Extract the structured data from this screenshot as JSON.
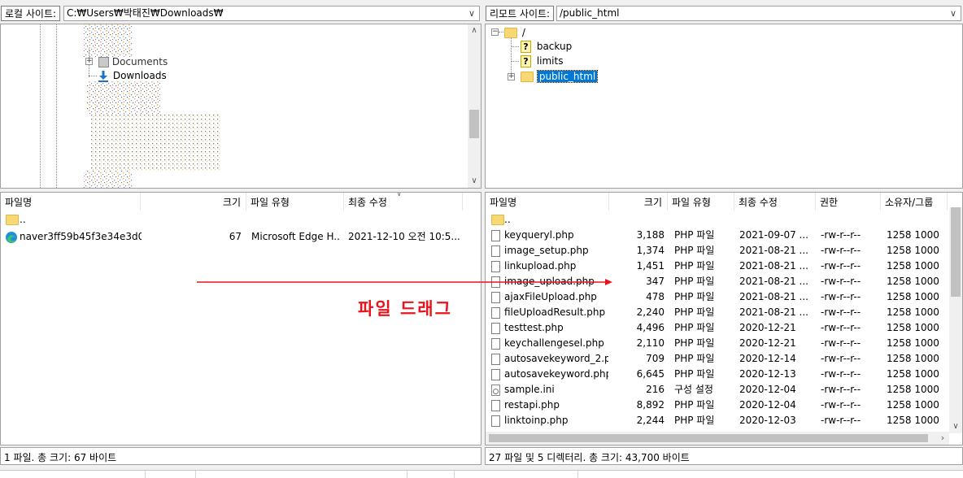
{
  "local": {
    "site_label": "로컬 사이트:",
    "site_path": "C:₩Users₩박태진₩Downloads₩",
    "tree": {
      "documents": "Documents",
      "downloads": "Downloads"
    },
    "columns": {
      "name": "파일명",
      "size": "크기",
      "type": "파일 유형",
      "modified": "최종 수정"
    },
    "files": [
      {
        "name": "..",
        "size": "",
        "type": "",
        "modified": "",
        "icon": "folder-icon"
      },
      {
        "name": "naver3ff59b45f3e34e3d0...",
        "size": "67",
        "type": "Microsoft Edge H...",
        "modified": "2021-12-10 오전 10:5...",
        "icon": "edge-icon"
      }
    ],
    "status": "1 파일. 총 크기: 67 바이트"
  },
  "remote": {
    "site_label": "리모트 사이트:",
    "site_path": "/public_html",
    "tree": {
      "root": "/",
      "children": [
        "backup",
        "limits",
        "public_html"
      ]
    },
    "columns": {
      "name": "파일명",
      "size": "크기",
      "type": "파일 유형",
      "modified": "최종 수정",
      "perm": "권한",
      "owner": "소유자/그룹"
    },
    "files": [
      {
        "name": "..",
        "size": "",
        "type": "",
        "modified": "",
        "perm": "",
        "owner": "",
        "icon": "folder-icon"
      },
      {
        "name": "keyqueryl.php",
        "size": "3,188",
        "type": "PHP 파일",
        "modified": "2021-09-07 ...",
        "perm": "-rw-r--r--",
        "owner": "1258 1000",
        "icon": "file-icon"
      },
      {
        "name": "image_setup.php",
        "size": "1,374",
        "type": "PHP 파일",
        "modified": "2021-08-21 ...",
        "perm": "-rw-r--r--",
        "owner": "1258 1000",
        "icon": "file-icon"
      },
      {
        "name": "linkupload.php",
        "size": "1,451",
        "type": "PHP 파일",
        "modified": "2021-08-21 ...",
        "perm": "-rw-r--r--",
        "owner": "1258 1000",
        "icon": "file-icon"
      },
      {
        "name": "image_upload.php",
        "size": "347",
        "type": "PHP 파일",
        "modified": "2021-08-21 ...",
        "perm": "-rw-r--r--",
        "owner": "1258 1000",
        "icon": "file-icon"
      },
      {
        "name": "ajaxFileUpload.php",
        "size": "478",
        "type": "PHP 파일",
        "modified": "2021-08-21 ...",
        "perm": "-rw-r--r--",
        "owner": "1258 1000",
        "icon": "file-icon"
      },
      {
        "name": "fileUploadResult.php",
        "size": "2,240",
        "type": "PHP 파일",
        "modified": "2021-08-21 ...",
        "perm": "-rw-r--r--",
        "owner": "1258 1000",
        "icon": "file-icon"
      },
      {
        "name": "testtest.php",
        "size": "4,496",
        "type": "PHP 파일",
        "modified": "2020-12-21",
        "perm": "-rw-r--r--",
        "owner": "1258 1000",
        "icon": "file-icon"
      },
      {
        "name": "keychallengesel.php",
        "size": "2,110",
        "type": "PHP 파일",
        "modified": "2020-12-21",
        "perm": "-rw-r--r--",
        "owner": "1258 1000",
        "icon": "file-icon"
      },
      {
        "name": "autosavekeyword_2.p...",
        "size": "709",
        "type": "PHP 파일",
        "modified": "2020-12-14",
        "perm": "-rw-r--r--",
        "owner": "1258 1000",
        "icon": "file-icon"
      },
      {
        "name": "autosavekeyword.php",
        "size": "6,645",
        "type": "PHP 파일",
        "modified": "2020-12-13",
        "perm": "-rw-r--r--",
        "owner": "1258 1000",
        "icon": "file-icon"
      },
      {
        "name": "sample.ini",
        "size": "216",
        "type": "구성 설정",
        "modified": "2020-12-04",
        "perm": "-rw-r--r--",
        "owner": "1258 1000",
        "icon": "settings-file-icon"
      },
      {
        "name": "restapi.php",
        "size": "8,892",
        "type": "PHP 파일",
        "modified": "2020-12-04",
        "perm": "-rw-r--r--",
        "owner": "1258 1000",
        "icon": "file-icon"
      },
      {
        "name": "linktoinp.php",
        "size": "2,244",
        "type": "PHP 파일",
        "modified": "2020-12-03",
        "perm": "-rw-r--r--",
        "owner": "1258 1000",
        "icon": "file-icon"
      }
    ],
    "status": "27 파일 및 5 디렉터리. 총 크기: 43,700 바이트"
  },
  "annotation": {
    "text": "파일 드래그",
    "color": "#e8141b"
  },
  "colors": {
    "selection": "#0078d7",
    "arrow": "#e8141b"
  }
}
